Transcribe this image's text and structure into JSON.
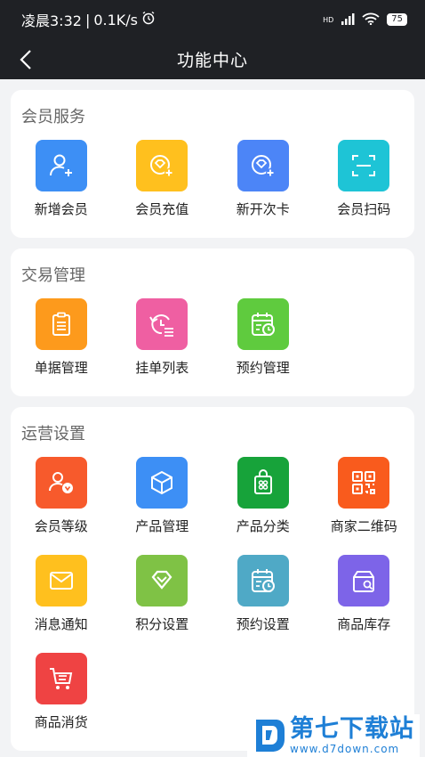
{
  "status_bar": {
    "time": "凌晨3:32",
    "speed": "0.1K/s",
    "network": "HD",
    "battery": "75"
  },
  "nav": {
    "title": "功能中心"
  },
  "sections": [
    {
      "title": "会员服务",
      "items": [
        {
          "label": "新增会员",
          "icon": "add-user-icon",
          "color": "#3d8ff5"
        },
        {
          "label": "会员充值",
          "icon": "diamond-plus-icon",
          "color": "#ffc01e"
        },
        {
          "label": "新开次卡",
          "icon": "diamond-plus-icon",
          "color": "#4c85f7"
        },
        {
          "label": "会员扫码",
          "icon": "scan-icon",
          "color": "#1ec4d6"
        }
      ]
    },
    {
      "title": "交易管理",
      "items": [
        {
          "label": "单据管理",
          "icon": "clipboard-icon",
          "color": "#fd9a1c"
        },
        {
          "label": "挂单列表",
          "icon": "history-list-icon",
          "color": "#ef5fa2"
        },
        {
          "label": "预约管理",
          "icon": "calendar-clock-icon",
          "color": "#5fcb3e"
        }
      ]
    },
    {
      "title": "运营设置",
      "items": [
        {
          "label": "会员等级",
          "icon": "member-level-icon",
          "color": "#f75a2c"
        },
        {
          "label": "产品管理",
          "icon": "box-icon",
          "color": "#3d8ff5"
        },
        {
          "label": "产品分类",
          "icon": "category-bag-icon",
          "color": "#17a33a"
        },
        {
          "label": "商家二维码",
          "icon": "qr-code-icon",
          "color": "#f95b1d"
        },
        {
          "label": "消息通知",
          "icon": "mail-icon",
          "color": "#ffc01e"
        },
        {
          "label": "积分设置",
          "icon": "points-diamond-icon",
          "color": "#7fc245"
        },
        {
          "label": "预约设置",
          "icon": "calendar-clock-icon",
          "color": "#4fa9c6"
        },
        {
          "label": "商品库存",
          "icon": "inventory-icon",
          "color": "#7d64e8"
        },
        {
          "label": "商品消货",
          "icon": "cart-icon",
          "color": "#ef4343"
        }
      ]
    }
  ],
  "watermark": {
    "main": "第七下载站",
    "sub": "www.d7down.com"
  }
}
